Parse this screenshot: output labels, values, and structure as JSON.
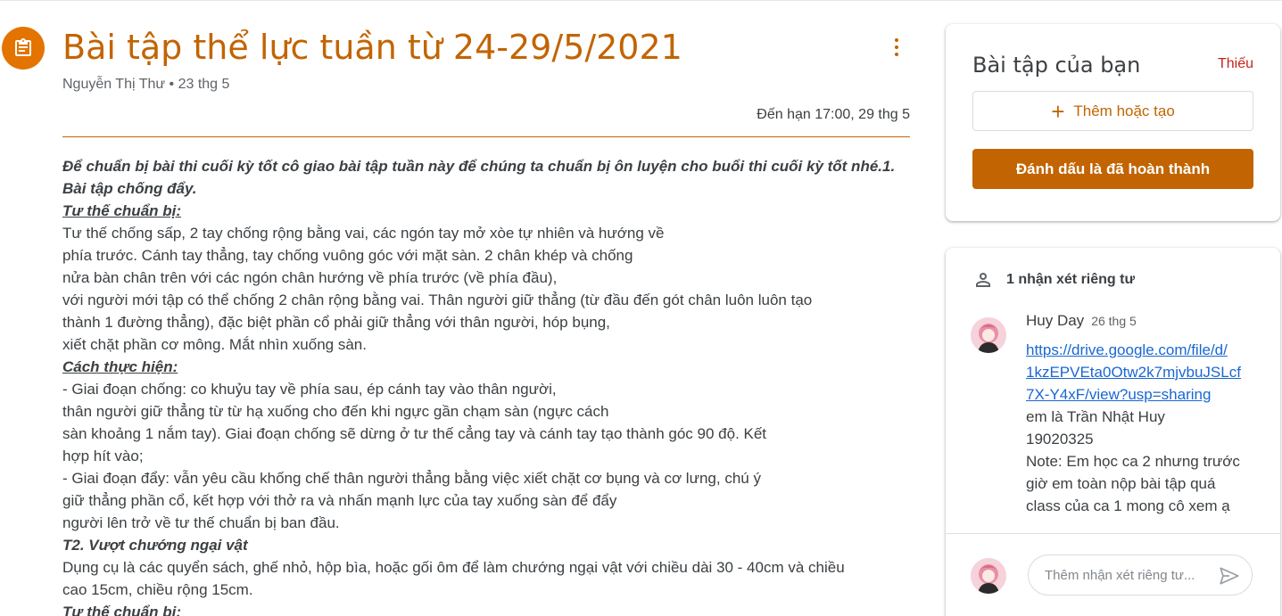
{
  "assignment": {
    "title": "Bài tập thể lực tuần từ 24-29/5/2021",
    "author": "Nguyễn Thị Thư",
    "separator": " • ",
    "date": "23 thg 5",
    "due": "Đến hạn 17:00, 29 thg 5"
  },
  "instructions": [
    {
      "text": "Để chuẩn bị bài thi cuối kỳ tốt cô giao bài tập tuần này để chúng ta chuẩn bị ôn luyện cho buổi thi cuối kỳ tốt nhé.1.",
      "style": "bi"
    },
    {
      "text": "Bài tập chống đẩy.",
      "style": "bi"
    },
    {
      "text": "Tư thế chuẩn bị:",
      "style": "bi-u"
    },
    {
      "text": "Tư thế chống sấp, 2 tay chống rộng bằng vai, các ngón tay mở xòe tự nhiên và hướng về",
      "style": ""
    },
    {
      "text": "phía trước. Cánh tay thẳng, tay chống vuông góc với mặt sàn. 2 chân khép và chống",
      "style": ""
    },
    {
      "text": "nửa bàn chân trên với các ngón chân hướng về phía trước (về phía đầu),",
      "style": ""
    },
    {
      "text": "với người mới tập có thể chống 2 chân rộng bằng vai. Thân người giữ thẳng (từ đầu đến gót chân luôn luôn tạo",
      "style": ""
    },
    {
      "text": "thành 1 đường thẳng), đặc biệt phần cổ phải giữ thẳng với thân người, hóp bụng,",
      "style": ""
    },
    {
      "text": "xiết chặt phần cơ mông. Mắt nhìn xuống sàn.",
      "style": ""
    },
    {
      "text": "Cách thực hiện:",
      "style": "bi-u"
    },
    {
      "text": "- Giai đoạn chống: co khuỷu tay về phía sau, ép cánh tay vào thân người,",
      "style": ""
    },
    {
      "text": "thân người giữ thẳng từ từ hạ xuống cho đến khi ngực gần chạm sàn (ngực cách",
      "style": ""
    },
    {
      "text": "sàn khoảng 1 nắm tay). Giai đoạn chống sẽ dừng ở tư thế cẳng tay và cánh tay tạo thành góc 90 độ. Kết",
      "style": ""
    },
    {
      "text": "hợp hít vào;",
      "style": ""
    },
    {
      "text": "- Giai đoạn đẩy: vẫn yêu cầu khống chế thân người thẳng bằng việc xiết chặt cơ bụng và cơ lưng, chú ý",
      "style": ""
    },
    {
      "text": "giữ thẳng phần cổ, kết hợp với thở ra và nhấn mạnh lực của tay xuống sàn để đẩy",
      "style": ""
    },
    {
      "text": "người lên trở về tư thế chuẩn bị ban đầu.",
      "style": ""
    },
    {
      "text": "T2. Vượt chướng ngại vật",
      "style": "bi"
    },
    {
      "text": "Dụng cụ là các quyển sách, ghế nhỏ,  hộp bìa, hoặc gối ôm để làm chướng ngại vật với  chiều dài 30 - 40cm và chiều",
      "style": ""
    },
    {
      "text": "cao 15cm, chiều rộng 15cm.",
      "style": ""
    },
    {
      "text": "Tư thế chuẩn bị:",
      "style": "bi-u"
    }
  ],
  "your_work": {
    "title": "Bài tập của bạn",
    "status": "Thiếu",
    "add_label": "Thêm hoặc tạo",
    "mark_done_label": "Đánh dấu là đã hoàn thành"
  },
  "private_comments": {
    "header": "1 nhận xét riêng tư",
    "comment": {
      "author": "Huy Day",
      "date": "26 thg 5",
      "link_lines": [
        "https://drive.google.com/file/d/",
        "1kzEPVEta0Otw2k7mjvbuJSLcf",
        "7X-Y4xF/view?usp=sharing"
      ],
      "text_lines": [
        "em là Trần Nhật Huy",
        "19020325",
        "Note: Em học ca 2 nhưng trước",
        "giờ em toàn nộp bài tập quá",
        "class của ca 1 mong cô xem ạ"
      ]
    },
    "input_placeholder": "Thêm nhận xét riêng tư..."
  },
  "colors": {
    "accent": "#c26401",
    "accent_icon_bg": "#e37400",
    "missing": "#c5221f",
    "link": "#1967d2"
  }
}
